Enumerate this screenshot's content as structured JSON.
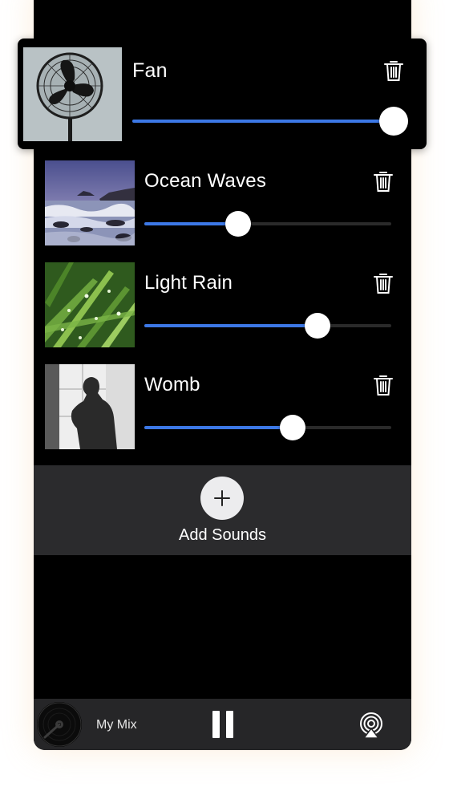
{
  "sounds": [
    {
      "name": "Fan",
      "volume": 1.0,
      "thumb_icon": "fan-photo"
    },
    {
      "name": "Ocean Waves",
      "volume": 0.38,
      "thumb_icon": "ocean-photo"
    },
    {
      "name": "Light Rain",
      "volume": 0.7,
      "thumb_icon": "rain-grass-photo"
    },
    {
      "name": "Womb",
      "volume": 0.6,
      "thumb_icon": "womb-silhouette-photo"
    }
  ],
  "add_sounds": {
    "label": "Add Sounds",
    "icon": "plus-icon"
  },
  "player": {
    "mix_name": "My Mix",
    "state": "playing",
    "icons": [
      "vinyl-icon",
      "pause-icon",
      "airplay-icon"
    ]
  },
  "colors": {
    "accent": "#3c78e6",
    "background": "#000000",
    "panel": "#2b2b2d",
    "player_bar": "#262628"
  }
}
